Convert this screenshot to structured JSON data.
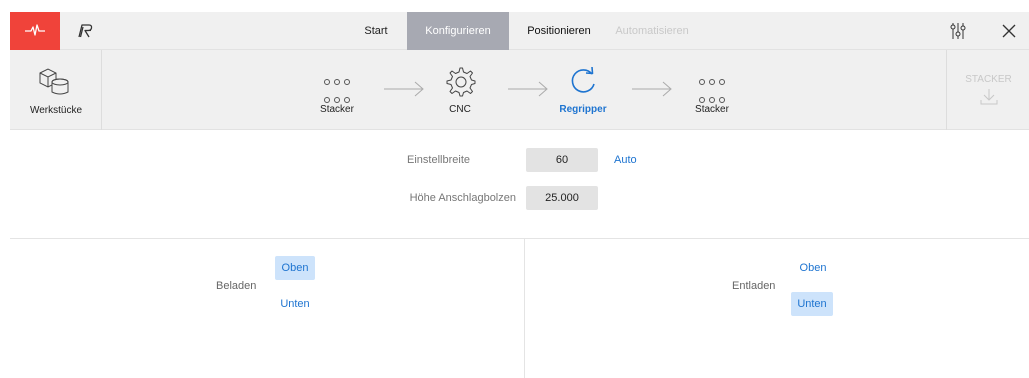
{
  "nav": {
    "tabs": [
      {
        "label": "Start",
        "state": "normal"
      },
      {
        "label": "Konfigurieren",
        "state": "active"
      },
      {
        "label": "Positionieren",
        "state": "normal"
      },
      {
        "label": "Automatisieren",
        "state": "disabled"
      }
    ],
    "logo_icon": "heartbeat-icon",
    "brand_icon": "brand-r-logo",
    "settings_icon": "sliders-icon",
    "close_icon": "close-icon"
  },
  "process": {
    "workpieces_label": "Werkstücke",
    "steps": [
      {
        "label": "Stacker",
        "icon": "stacker-dots-icon",
        "active": false
      },
      {
        "label": "CNC",
        "icon": "gear-icon",
        "active": false
      },
      {
        "label": "Regripper",
        "icon": "refresh-icon",
        "active": true
      },
      {
        "label": "Stacker",
        "icon": "stacker-dots-icon",
        "active": false
      }
    ],
    "stacker_button_label": "STACKER"
  },
  "form": {
    "einstellbreite_label": "Einstellbreite",
    "einstellbreite_value": "60",
    "auto_label": "Auto",
    "hoehe_label": "Höhe Anschlagbolzen",
    "hoehe_value": "25.000"
  },
  "beladen": {
    "label": "Beladen",
    "options": [
      "Oben",
      "Unten"
    ],
    "selected": "Oben"
  },
  "entladen": {
    "label": "Entladen",
    "options": [
      "Oben",
      "Unten"
    ],
    "selected": "Unten"
  },
  "colors": {
    "accent": "#1e74d0",
    "logo_red": "#f0433a",
    "active_tab": "#a7a9b2",
    "selected_option": "#cde3fb"
  }
}
